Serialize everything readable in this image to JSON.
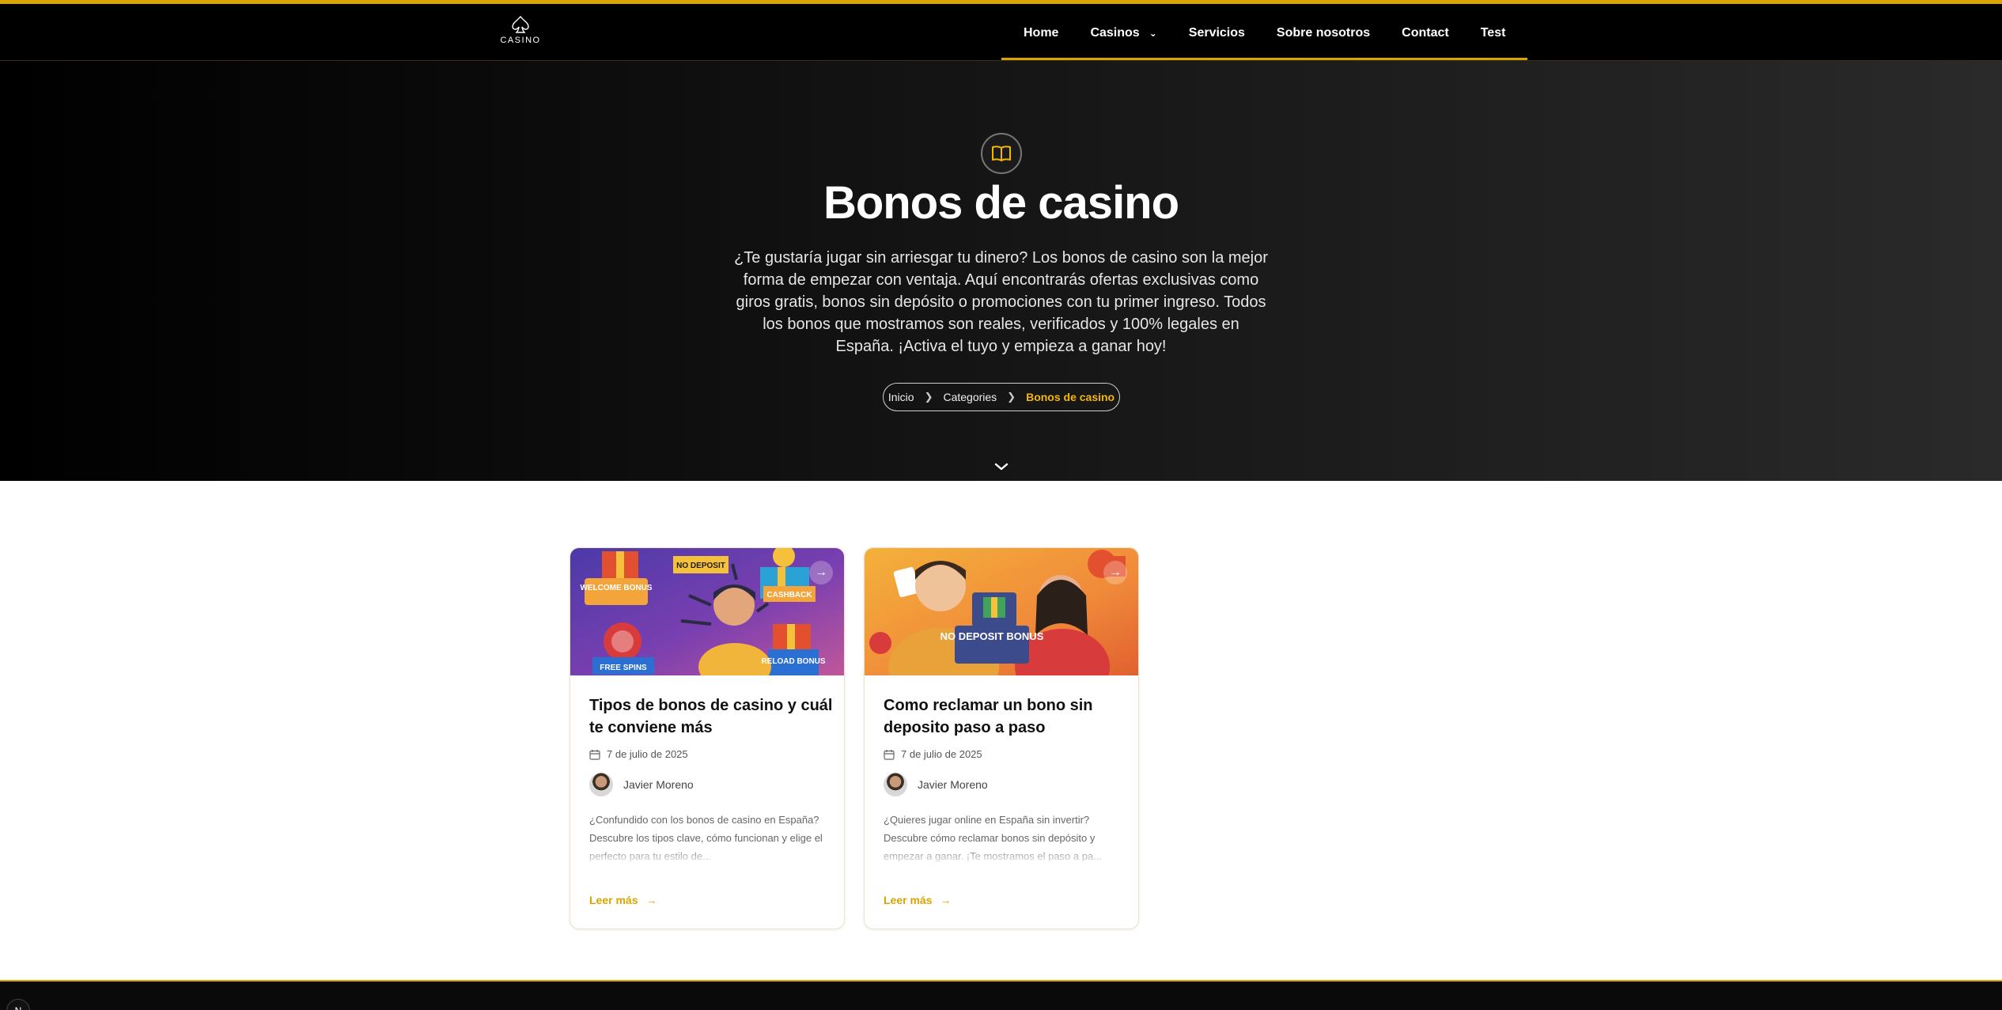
{
  "header": {
    "logo_text": "CASINO",
    "nav": [
      {
        "label": "Home"
      },
      {
        "label": "Casinos",
        "has_dropdown": true
      },
      {
        "label": "Servicios"
      },
      {
        "label": "Sobre nosotros"
      },
      {
        "label": "Contact"
      },
      {
        "label": "Test"
      }
    ]
  },
  "hero": {
    "icon": "book-open-icon",
    "title": "Bonos de casino",
    "description": "¿Te gustaría jugar sin arriesgar tu dinero? Los bonos de casino son la mejor forma de empezar con ventaja. Aquí encontrarás ofertas exclusivas como giros gratis, bonos sin depósito o promociones con tu primer ingreso. Todos los bonos que mostramos son reales, verificados y 100% legales en España. ¡Activa el tuyo y empieza a ganar hoy!",
    "breadcrumb": {
      "items": [
        "Inicio",
        "Categories"
      ],
      "current": "Bonos de casino"
    }
  },
  "articles": [
    {
      "title": "Tipos de bonos de casino y cuál te conviene más",
      "date": "7 de julio de 2025",
      "author": "Javier Moreno",
      "excerpt": "¿Confundido con los bonos de casino en España? Descubre los tipos clave, cómo funcionan y elige el perfecto para tu estilo de...",
      "read_more": "Leer más",
      "image_labels": [
        "WELCOME BONUS",
        "NO DEPOSIT",
        "CASHBACK",
        "FREE SPINS",
        "RELOAD BONUS"
      ]
    },
    {
      "title": "Como reclamar un bono sin deposito paso a paso",
      "date": "7 de julio de 2025",
      "author": "Javier Moreno",
      "excerpt": "¿Quieres jugar online en España sin invertir? Descubre cómo reclamar bonos sin depósito y empezar a ganar. ¡Te mostramos el paso a pa...",
      "read_more": "Leer más",
      "image_labels": [
        "NO DEPOSIT BONUS"
      ]
    }
  ],
  "colors": {
    "accent": "#d9a400",
    "breadcrumb_current": "#f2b705",
    "header_bg": "#000000"
  }
}
